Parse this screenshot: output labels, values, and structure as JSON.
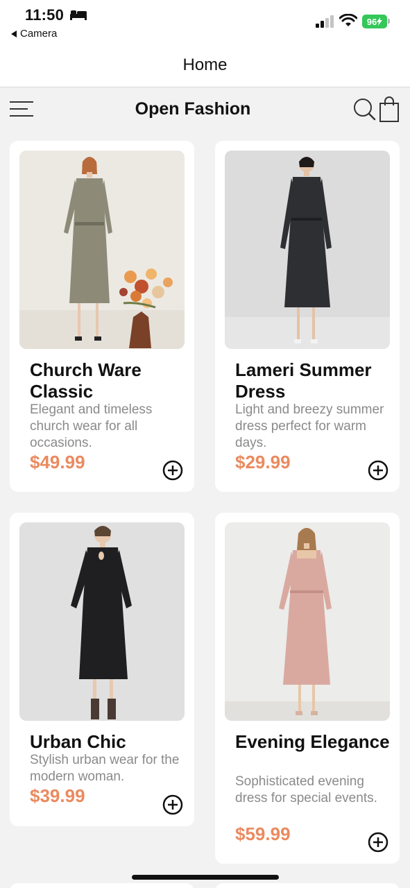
{
  "status": {
    "time": "11:50",
    "back_app": "Camera",
    "battery": "96"
  },
  "nav": {
    "title": "Home"
  },
  "header": {
    "brand": "Open Fashion"
  },
  "products": [
    {
      "title": "Church Ware Classic",
      "description": "Elegant and timeless church wear for all occasions.",
      "price": "$49.99"
    },
    {
      "title": "Lameri Summer Dress",
      "description": "Light and breezy summer dress perfect for warm days.",
      "price": "$29.99"
    },
    {
      "title": "Urban Chic",
      "description": "Stylish urban wear for the modern woman.",
      "price": "$39.99"
    },
    {
      "title": "Evening Elegance",
      "description": "Sophisticated evening dress for special events.",
      "price": "$59.99"
    }
  ],
  "colors": {
    "price": "#ea8a5f",
    "background": "#f2f2f2",
    "battery": "#34c759"
  },
  "icons": [
    "menu-icon",
    "search-icon",
    "shopping-bag-icon",
    "add-circle-icon"
  ]
}
